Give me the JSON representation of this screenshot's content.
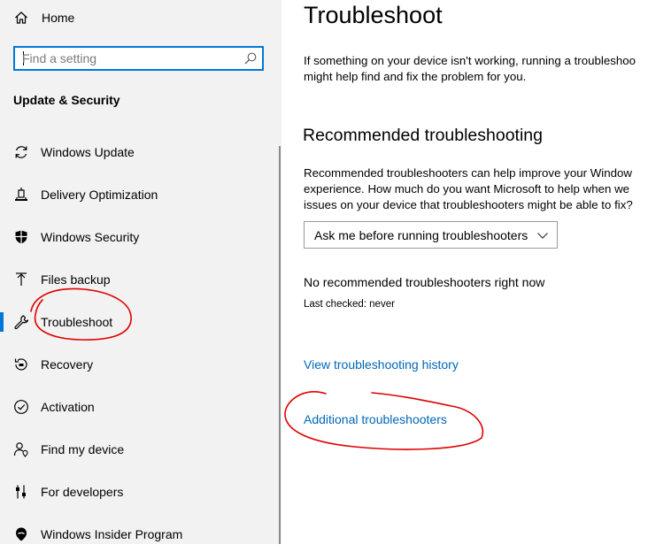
{
  "sidebar": {
    "home_label": "Home",
    "search": {
      "placeholder": "Find a setting",
      "value": ""
    },
    "section_title": "Update & Security",
    "items": [
      {
        "label": "Windows Update",
        "icon": "refresh-icon",
        "selected": false
      },
      {
        "label": "Delivery Optimization",
        "icon": "delivery-optimization-icon",
        "selected": false
      },
      {
        "label": "Windows Security",
        "icon": "shield-icon",
        "selected": false
      },
      {
        "label": "Files backup",
        "icon": "backup-arrow-icon",
        "selected": false
      },
      {
        "label": "Troubleshoot",
        "icon": "wrench-icon",
        "selected": true
      },
      {
        "label": "Recovery",
        "icon": "recovery-icon",
        "selected": false
      },
      {
        "label": "Activation",
        "icon": "check-circle-icon",
        "selected": false
      },
      {
        "label": "Find my device",
        "icon": "person-location-icon",
        "selected": false
      },
      {
        "label": "For developers",
        "icon": "developer-tools-icon",
        "selected": false
      },
      {
        "label": "Windows Insider Program",
        "icon": "insider-icon",
        "selected": false
      }
    ]
  },
  "main": {
    "title": "Troubleshoot",
    "intro_line1": "If something on your device isn't working, running a troubleshoo",
    "intro_line2": "might help find and fix the problem for you.",
    "recommended_heading": "Recommended troubleshooting",
    "recommended_line1": "Recommended troubleshooters can help improve your Window",
    "recommended_line2": "experience. How much do you want Microsoft to help when we",
    "recommended_line3": "issues on your device that troubleshooters might be able to fix?",
    "dropdown_value": "Ask me before running troubleshooters",
    "status_text": "No recommended troubleshooters right now",
    "last_checked": "Last checked: never",
    "history_link": "View troubleshooting history",
    "additional_link": "Additional troubleshooters"
  },
  "colors": {
    "accent": "#0078d7",
    "link": "#0067b8",
    "sidebar_bg": "#f2f2f2",
    "annotation": "#e00000"
  }
}
